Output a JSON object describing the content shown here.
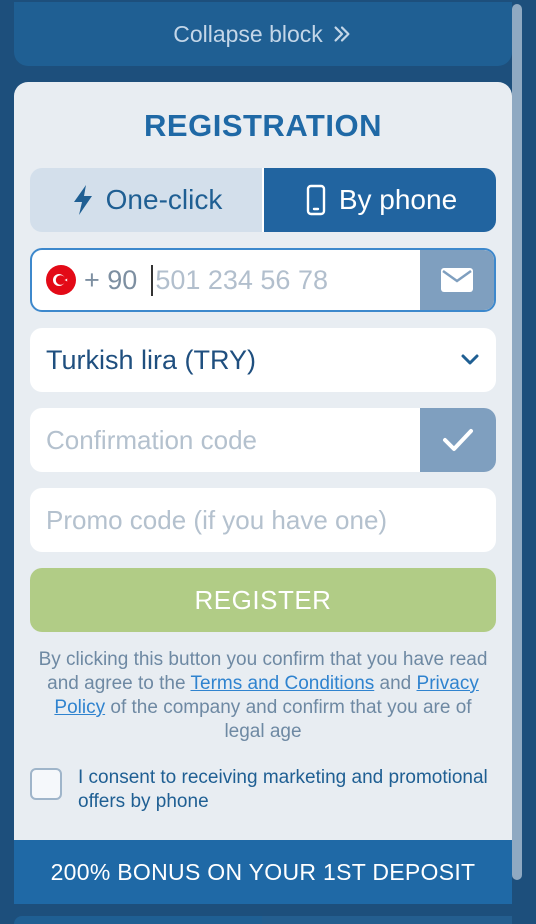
{
  "collapse": {
    "label": "Collapse block"
  },
  "form": {
    "title": "REGISTRATION",
    "tabs": [
      {
        "label": "One-click",
        "icon": "lightning-icon",
        "active": false
      },
      {
        "label": "By phone",
        "icon": "phone-icon",
        "active": true
      }
    ],
    "phone": {
      "flag": "turkey-flag-icon",
      "country_code": "+ 90",
      "value": "",
      "placeholder": "501 234 56 78"
    },
    "currency": {
      "selected": "Turkish lira (TRY)"
    },
    "confirmation": {
      "value": "",
      "placeholder": "Confirmation code"
    },
    "promo": {
      "value": "",
      "placeholder": "Promo code (if you have one)"
    },
    "register_label": "REGISTER",
    "disclaimer": {
      "part1": "By clicking this button you confirm that you have read and agree to the",
      "terms_link": "Terms and Conditions",
      "part2": "and",
      "privacy_link": "Privacy Policy",
      "part3": "of the company and confirm that you are of legal age"
    },
    "consent": {
      "label": "I consent to receiving marketing and promotional offers by phone",
      "checked": false
    },
    "bonus": "200% BONUS ON YOUR 1ST DEPOSIT"
  },
  "colors": {
    "background": "#1d4f7c",
    "accent": "#1f69a6",
    "register": "#b1cc86",
    "card": "#e8edf2"
  }
}
